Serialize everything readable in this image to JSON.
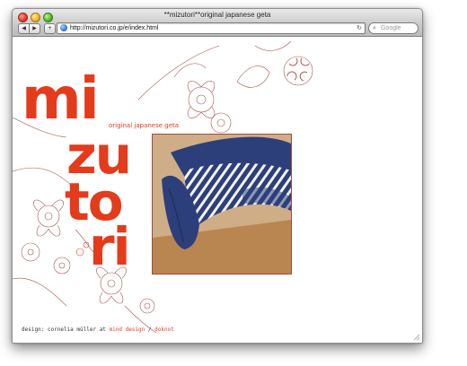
{
  "window": {
    "title": "**mizutori**original japanese geta"
  },
  "toolbar": {
    "back_glyph": "◀",
    "forward_glyph": "▶",
    "add_glyph": "+",
    "url": "http://mizutori.co.jp/e/index.html",
    "reload_glyph": "↻",
    "search_placeholder": "Google",
    "search_glyph": "⌕"
  },
  "page": {
    "logo_line1": "mi",
    "logo_line2": "zu",
    "logo_line3": "to",
    "logo_line4": "ri",
    "tagline": "original japanese geta",
    "credit_prefix": "design: cornelia müller at",
    "credit_link1": "mind design",
    "credit_sep": "/",
    "credit_link2": "doknot"
  },
  "colors": {
    "accent": "#e33b1b",
    "indigo": "#2c3f7a"
  }
}
